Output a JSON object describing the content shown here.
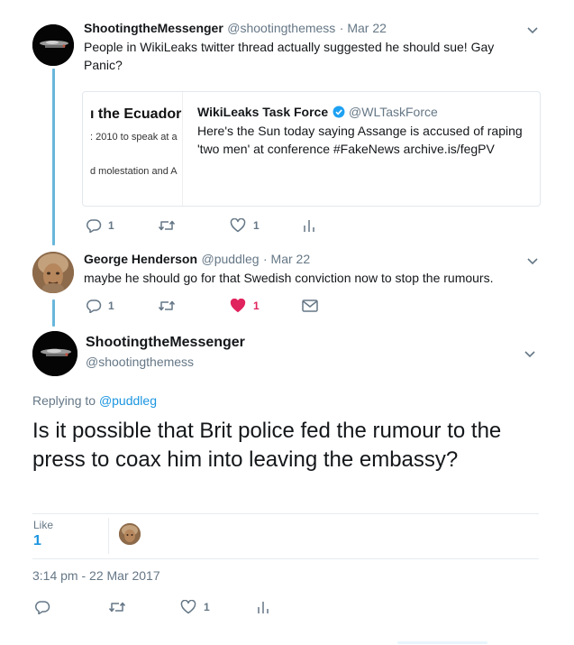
{
  "colors": {
    "accent": "#1b95e0",
    "thread": "#69b6db",
    "like": "#e0245e",
    "muted": "#657786"
  },
  "tweet1": {
    "name": "ShootingtheMessenger",
    "handle": "@shootingthemess",
    "date": "· Mar 22",
    "text": "People in WikiLeaks twitter thread actually suggested he should sue! Gay Panic?",
    "replies": "1",
    "likes": "1",
    "quote": {
      "image_heading": "ı the Ecuadoria",
      "image_line1": ": 2010 to speak at a",
      "image_line2": "d molestation and A",
      "name": "WikiLeaks Task Force",
      "handle": "@WLTaskForce",
      "text": "Here's the Sun today saying Assange is accused of raping 'two men' at conference #FakeNews archive.is/fegPV"
    }
  },
  "tweet2": {
    "name": "George Henderson",
    "handle": "@puddleg",
    "date": "· Mar 22",
    "text": "maybe he should go for that Swedish conviction now to stop the rumours.",
    "replies": "1",
    "likes": "1"
  },
  "main": {
    "name": "ShootingtheMessenger",
    "handle": "@shootingthemess",
    "replying_prefix": "Replying to",
    "replying_to": "@puddleg",
    "text": "Is it possible that Brit police fed the rumour to the press to coax him into leaving the embassy?",
    "likes_label": "Like",
    "likes_count": "1",
    "timestamp": "3:14 pm - 22 Mar 2017",
    "likes": "1"
  },
  "icons": [
    "reply-icon",
    "retweet-icon",
    "heart-icon",
    "analytics-icon",
    "message-icon",
    "chevron-down-icon",
    "verified-icon"
  ]
}
